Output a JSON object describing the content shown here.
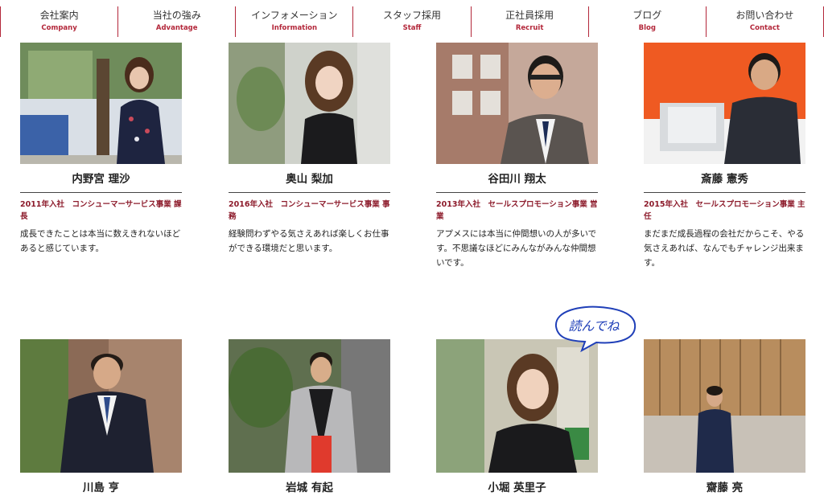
{
  "nav": [
    {
      "jp": "会社案内",
      "en": "Company"
    },
    {
      "jp": "当社の強み",
      "en": "Advantage"
    },
    {
      "jp": "インフォメーション",
      "en": "Information"
    },
    {
      "jp": "スタッフ採用",
      "en": "Staff"
    },
    {
      "jp": "正社員採用",
      "en": "Recruit"
    },
    {
      "jp": "ブログ",
      "en": "Blog"
    },
    {
      "jp": "お問い合わせ",
      "en": "Contact"
    }
  ],
  "staff_row1": [
    {
      "name": "内野宮 理沙",
      "role": "2011年入社　コンシューマーサービス事業 課長",
      "message": "成長できたことは本当に数えきれないほどあると感じています。"
    },
    {
      "name": "奥山 梨加",
      "role": "2016年入社　コンシューマーサービス事業 事務",
      "message": "経験問わずやる気さえあれば楽しくお仕事ができる環境だと思います。"
    },
    {
      "name": "谷田川 翔太",
      "role": "2013年入社　セールスプロモーション事業 営業",
      "message": "アプメスには本当に仲間想いの人が多いです。不思議なほどにみんながみんな仲間想いです。"
    },
    {
      "name": "斎藤 憲秀",
      "role": "2015年入社　セールスプロモーション事業 主任",
      "message": "まだまだ成長過程の会社だからこそ、やる気さえあれば、なんでもチャレンジ出来ます。"
    }
  ],
  "staff_row2": [
    {
      "name": "川島 亨"
    },
    {
      "name": "岩城 有起"
    },
    {
      "name": "小堀 英里子"
    },
    {
      "name": "齋藤 亮"
    }
  ],
  "bubble": {
    "text": "読んでね"
  },
  "colors": {
    "accent": "#b3273a",
    "role_text": "#8d1c2c"
  }
}
